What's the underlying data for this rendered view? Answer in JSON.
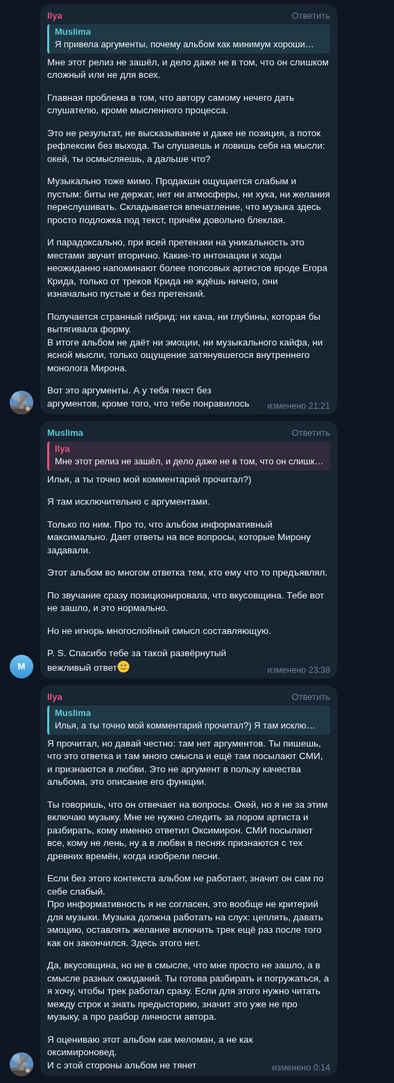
{
  "messages": [
    {
      "sender": "Ilya",
      "color": "#e5537c",
      "reply_action": "Ответить",
      "quote": {
        "sender": "Muslima",
        "color": "#5cc5d0",
        "text": "Я привела аргументы, почему альбом как минимум хороши…"
      },
      "paragraphs": [
        "Мне этот релиз не зашёл, и дело даже не в том, что он слишком сложный или не для всех.",
        "Главная проблема в том, что автору самому нечего дать слушателю, кроме мысленного процесса.",
        "Это не результат, не высказывание и даже не позиция, а поток рефлексии без выхода. Ты слушаешь и ловишь себя на мысли: окей, ты осмысляешь, а дальше что?",
        "Музыкально тоже мимо. Продакшн ощущается слабым и пустым: биты не держат, нет ни атмосферы, ни хука, ни желания переслушивать. Складывается впечатление, что музыка здесь просто подложка под текст, причём довольно блеклая.",
        "И парадоксально, при всей претензии на уникальность это местами звучит вторично. Какие-то интонации и ходы неожиданно напоминают более попсовых артистов вроде Егора Крида, только от треков Крида не ждёшь ничего, они изначально пустые и без претензий.",
        "Получается странный гибрид: ни кача, ни глубины, которая бы вытягивала форму.\nВ итоге альбом не даёт ни эмоции, ни музыкального кайфа, ни ясной мысли, только ощущение затянувшегося внутреннего монолога Мирона.",
        "Вот это аргументы. А у тебя текст без аргументов, кроме того, что тебе понравилось"
      ],
      "time": "изменено 21:21"
    },
    {
      "sender": "Muslima",
      "color": "#5cc5d0",
      "reply_action": "Ответить",
      "quote": {
        "sender": "Ilya",
        "color": "#e5537c",
        "text": "Мне этот релиз не зашёл, и дело даже не в том, что он слишк…"
      },
      "paragraphs": [
        "Илья, а ты точно мой комментарий прочитал?)",
        "Я там исключительно с аргументами.",
        "Только по ним. Про то, что альбом информативный максимально. Дает ответы на все вопросы, которые Мирону задавали.",
        "Этот альбом во многом ответка тем, кто ему что то предъявлял.",
        "По звучание сразу позиционировала, что вкусовщина. Тебе вот не зашло, и это нормально.",
        "Но не игнорь многослойный смысл составляющую.",
        "P. S. Спасибо тебе за такой развёрнутый вежливый ответ"
      ],
      "smiley": true,
      "time": "изменено 23:38",
      "avatar": {
        "kind": "letter",
        "letter": "M"
      }
    },
    {
      "sender": "Ilya",
      "color": "#e5537c",
      "reply_action": "Ответить",
      "quote": {
        "sender": "Muslima",
        "color": "#5cc5d0",
        "text": "Илья, а ты точно мой комментарий прочитал?)  Я там исклю…"
      },
      "paragraphs": [
        "Я прочитал, но давай честно: там нет аргументов. Ты пишешь, что это ответка и там много смысла и ещё там посылают СМИ, и признаются в любви. Это не аргумент в пользу качества альбома, это описание его функции.",
        "Ты говоришь, что он отвечает на вопросы. Окей, но я не за этим включаю музыку. Мне не нужно следить за лором артиста и разбирать, кому именно ответил Оксимирон. СМИ посылают все, кому не лень, ну а в любви в песнях признаются с тех древних времён, когда изобрели песни.",
        "Если без этого контекста альбом не работает, значит он сам по себе слабый.\nПро информативность я не согласен, это вообще не критерий для музыки. Музыка должна работать на слух: цеплять, давать эмоцию, оставлять желание включить трек ещё раз после того как он закончился. Здесь этого нет.",
        "Да, вкусовщина, но не в смысле, что мне просто не зашло, а в смысле разных ожиданий. Ты готова разбирать и погружаться, а я хочу, чтобы трек работал сразу. Если для этого нужно читать между строк и знать предысторию, значит это уже не про музыку, а про разбор личности автора.",
        "Я оцениваю этот альбом как меломан, а не как оксимироновед.\nИ с этой стороны альбом не тянет"
      ],
      "time": "изменено 0:14"
    }
  ]
}
